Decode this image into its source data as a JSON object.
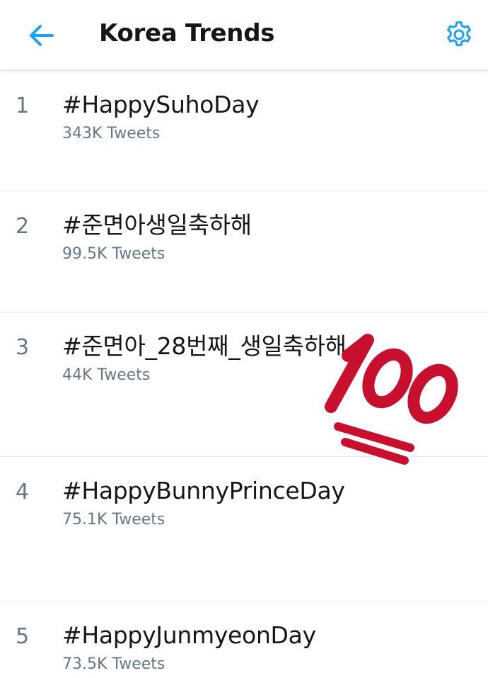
{
  "header": {
    "title": "Korea Trends",
    "back_icon": "arrow-left-icon",
    "settings_icon": "gear-icon",
    "accent_color": "#1da1f2"
  },
  "trends": [
    {
      "rank": "1",
      "name": "#HappySuhoDay",
      "count": "343K Tweets"
    },
    {
      "rank": "2",
      "name": "#준면아생일축하해",
      "count": "99.5K Tweets"
    },
    {
      "rank": "3",
      "name": "#준면아_28번째_생일축하해",
      "count": "44K Tweets"
    },
    {
      "rank": "4",
      "name": "#HappyBunnyPrinceDay",
      "count": "75.1K Tweets"
    },
    {
      "rank": "5",
      "name": "#HappyJunmyeonDay",
      "count": "73.5K Tweets"
    }
  ],
  "overlay": {
    "icon": "hundred-points-emoji-icon",
    "color": "#c8102e"
  }
}
